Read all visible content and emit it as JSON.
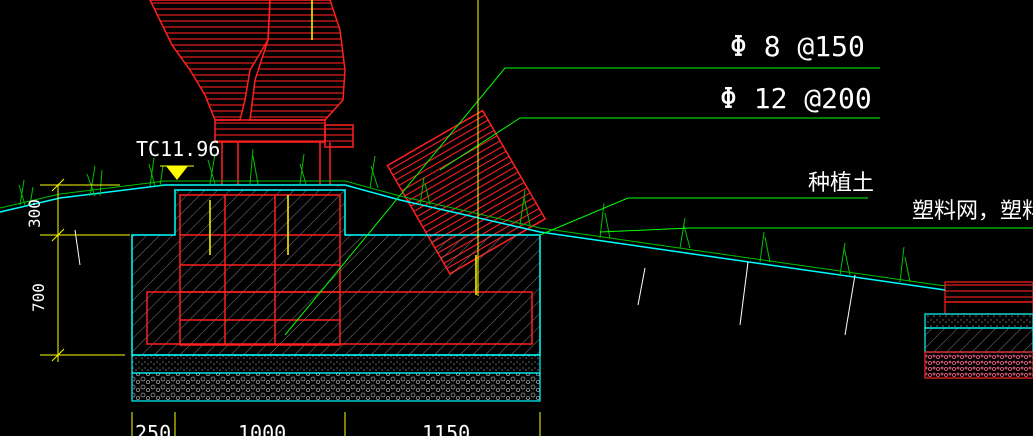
{
  "drawing": {
    "elevation_label": "TC11.96",
    "rebar_callouts": [
      {
        "text": "Φ 8 @150"
      },
      {
        "text": "Φ 12 @200"
      }
    ],
    "material_callouts": [
      {
        "text": "种植土"
      },
      {
        "text": "塑料网，塑料"
      }
    ],
    "vertical_dimensions": [
      {
        "text": "300"
      },
      {
        "text": "700"
      }
    ],
    "horizontal_dimensions": [
      {
        "text": "250"
      },
      {
        "text": "1000"
      },
      {
        "text": "1150"
      }
    ],
    "colors": {
      "background": "#000000",
      "section_outline": "#00ffff",
      "rebar": "#ff2020",
      "leader_lines": "#00ff00",
      "grass": "#00c000",
      "dimensions": "#ffff00",
      "text": "#ffffff"
    }
  }
}
